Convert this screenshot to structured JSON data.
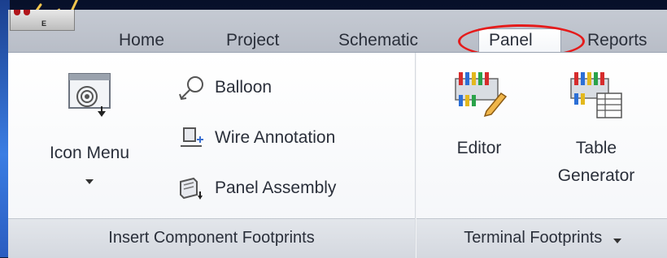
{
  "tabs": [
    {
      "label": "Home"
    },
    {
      "label": "Project"
    },
    {
      "label": "Schematic"
    },
    {
      "label": "Panel",
      "active": true
    },
    {
      "label": "Reports"
    }
  ],
  "app_button": {
    "mark": "E"
  },
  "groups": {
    "insert": {
      "label": "Insert Component Footprints",
      "icon_menu": {
        "label": "Icon Menu"
      },
      "balloon": {
        "label": "Balloon"
      },
      "wire_annotation": {
        "label": "Wire Annotation"
      },
      "panel_assembly": {
        "label": "Panel Assembly"
      }
    },
    "terminal": {
      "label": "Terminal Footprints",
      "editor": {
        "label": "Editor"
      },
      "table_generator": {
        "label_line1": "Table",
        "label_line2": "Generator"
      }
    }
  },
  "colors": {
    "highlight": "#e51b1b",
    "accent_streak": "#f3c64d"
  }
}
